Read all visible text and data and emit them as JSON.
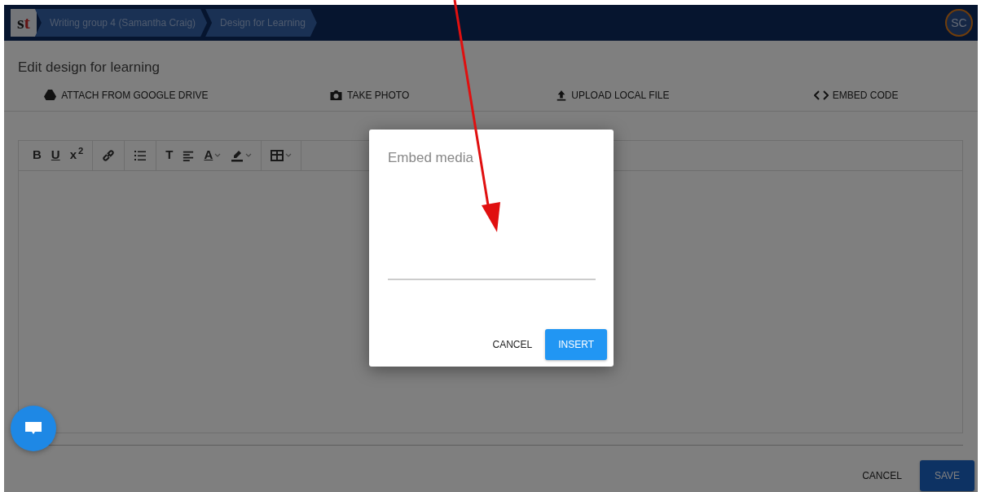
{
  "navbar": {
    "logo": "st",
    "breadcrumbs": [
      {
        "label": "Writing group 4 (Samantha Craig)"
      },
      {
        "label": "Design for Learning"
      }
    ],
    "avatar": "SC"
  },
  "page_title": "Edit design for learning",
  "attach_actions": [
    {
      "kind": "drive",
      "label": "ATTACH FROM GOOGLE DRIVE"
    },
    {
      "kind": "camera",
      "label": "TAKE PHOTO"
    },
    {
      "kind": "upload",
      "label": "UPLOAD LOCAL FILE"
    },
    {
      "kind": "code",
      "label": "EMBED CODE"
    }
  ],
  "toolbar_groups": [
    [
      {
        "kind": "text",
        "label": "B",
        "dropdown": false
      },
      {
        "kind": "underline",
        "label": "U",
        "dropdown": false
      },
      {
        "kind": "text",
        "label": "x$^{2}$",
        "dropdown": false
      }
    ],
    [
      {
        "kind": "link",
        "dropdown": false
      }
    ],
    [
      {
        "kind": "list",
        "dropdown": false
      }
    ],
    [
      {
        "kind": "text",
        "label": "T",
        "dropdown": false
      },
      {
        "kind": "align",
        "dropdown": false
      },
      {
        "kind": "underline",
        "label": "A",
        "dropdown": true
      },
      {
        "kind": "highlight",
        "dropdown": true
      }
    ],
    [
      {
        "kind": "table",
        "dropdown": true
      }
    ]
  ],
  "footer_buttons": [
    {
      "kind": "text",
      "label": "CANCEL"
    },
    {
      "kind": "primary",
      "label": "SAVE"
    }
  ],
  "dialog": {
    "title": "Embed media",
    "buttons": [
      {
        "kind": "text",
        "label": "CANCEL"
      },
      {
        "kind": "primary",
        "label": "INSERT"
      }
    ]
  }
}
